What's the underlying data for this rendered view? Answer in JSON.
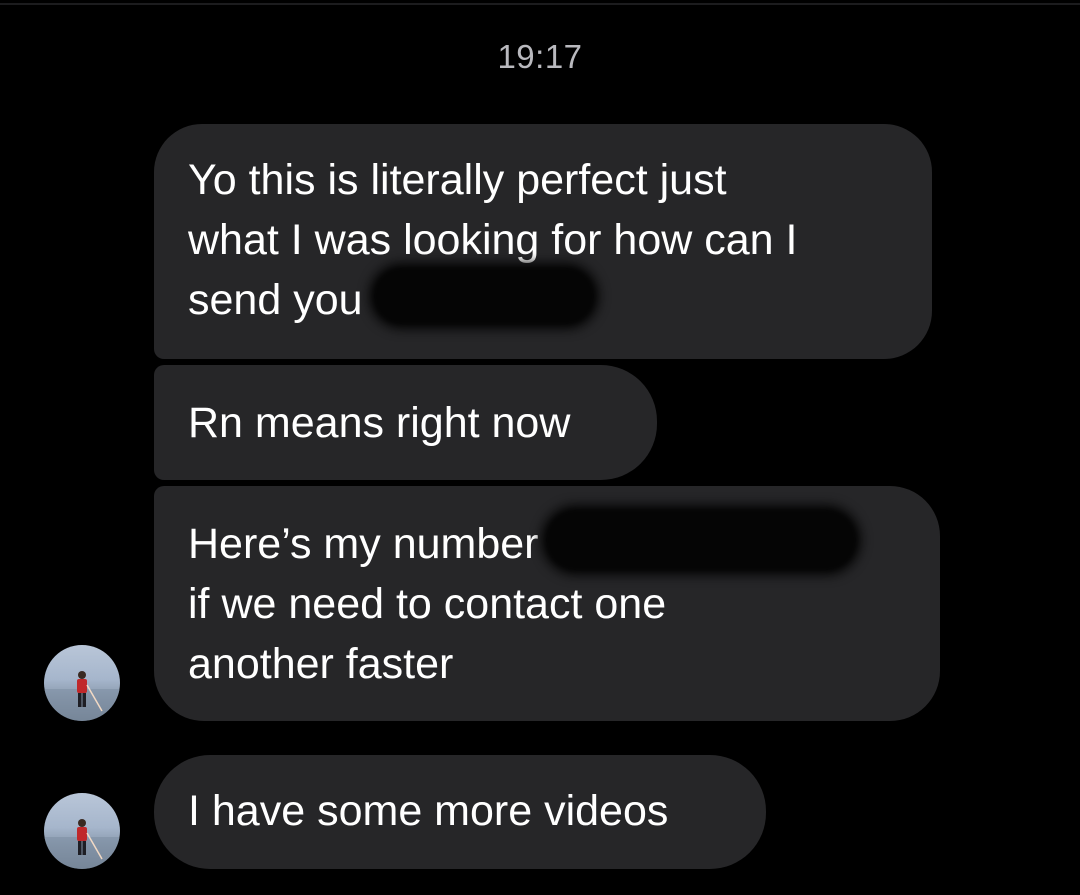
{
  "conversation": {
    "timestamp": "19:17",
    "messages": [
      {
        "lines": [
          "Yo this is literally perfect just",
          "what I was looking for how can I",
          "send you"
        ]
      },
      {
        "lines": [
          "Rn means right now"
        ]
      },
      {
        "lines": [
          "Here’s my number",
          "if we need to contact one",
          "another faster"
        ]
      },
      {
        "lines": [
          "I have some more videos"
        ]
      }
    ]
  },
  "colors": {
    "background": "#000000",
    "bubble": "#262628",
    "text": "#ffffff",
    "timestamp": "#b9b9be"
  },
  "icons": [
    "contact-avatar",
    "redaction-scribble"
  ]
}
